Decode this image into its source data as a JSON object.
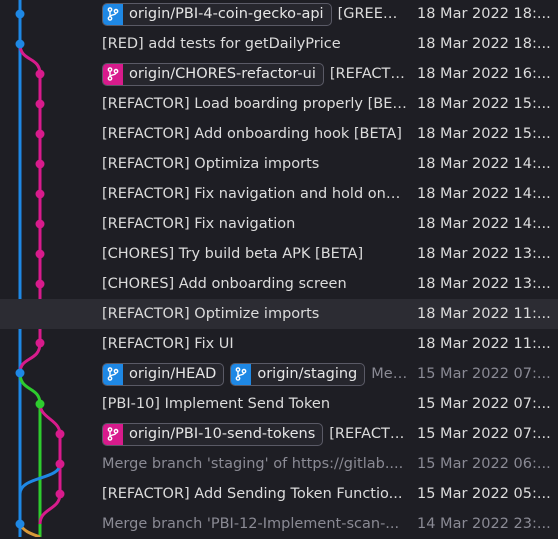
{
  "colors": {
    "blue": "#1e88e5",
    "magenta": "#d81b8c",
    "green": "#2ecc2e",
    "orange": "#d99a3a"
  },
  "commits": [
    {
      "refs": [
        {
          "name": "origin/PBI-4-coin-gecko-api",
          "color": "#1e88e5"
        }
      ],
      "message": "[GREEN] ...",
      "date": "18 Mar 2022 18:...",
      "dim": false
    },
    {
      "refs": [],
      "message": "[RED] add tests for getDailyPrice",
      "date": "18 Mar 2022 18:...",
      "dim": false
    },
    {
      "refs": [
        {
          "name": "origin/CHORES-refactor-ui",
          "color": "#d81b8c"
        }
      ],
      "message": "[REFACTO...",
      "date": "18 Mar 2022 16:...",
      "dim": false
    },
    {
      "refs": [],
      "message": "[REFACTOR] Load boarding properly [BET...",
      "date": "18 Mar 2022 15:...",
      "dim": false
    },
    {
      "refs": [],
      "message": "[REFACTOR] Add onboarding hook [BETA]",
      "date": "18 Mar 2022 15:...",
      "dim": false
    },
    {
      "refs": [],
      "message": "[REFACTOR] Optimiza imports",
      "date": "18 Mar 2022 14:...",
      "dim": false
    },
    {
      "refs": [],
      "message": "[REFACTOR] Fix navigation and hold onb...",
      "date": "18 Mar 2022 14:...",
      "dim": false
    },
    {
      "refs": [],
      "message": "[REFACTOR] Fix navigation",
      "date": "18 Mar 2022 14:...",
      "dim": false
    },
    {
      "refs": [],
      "message": "[CHORES] Try build beta APK [BETA]",
      "date": "18 Mar 2022 13:...",
      "dim": false
    },
    {
      "refs": [],
      "message": "[CHORES] Add onboarding screen",
      "date": "18 Mar 2022 13:...",
      "dim": false
    },
    {
      "refs": [],
      "message": "[REFACTOR] Optimize imports",
      "date": "18 Mar 2022 11:...",
      "dim": false,
      "selected": true
    },
    {
      "refs": [],
      "message": "[REFACTOR] Fix UI",
      "date": "18 Mar 2022 11:...",
      "dim": false
    },
    {
      "refs": [
        {
          "name": "origin/HEAD",
          "color": "#1e88e5"
        },
        {
          "name": "origin/staging",
          "color": "#1e88e5"
        }
      ],
      "message": "Mer...",
      "date": "15 Mar 2022 07:...",
      "dim": true
    },
    {
      "refs": [],
      "message": "[PBI-10] Implement Send Token",
      "date": "15 Mar 2022 07:...",
      "dim": false
    },
    {
      "refs": [
        {
          "name": "origin/PBI-10-send-tokens",
          "color": "#d81b8c"
        }
      ],
      "message": "[REFACTO...",
      "date": "15 Mar 2022 07:...",
      "dim": false
    },
    {
      "refs": [],
      "message": "Merge branch 'staging' of https://gitlab....",
      "date": "15 Mar 2022 06:...",
      "dim": true
    },
    {
      "refs": [],
      "message": "[REFACTOR] Add Sending Token Functio...",
      "date": "15 Mar 2022 05:...",
      "dim": false
    },
    {
      "refs": [],
      "message": "Merge branch 'PBI-12-Implement-scan-...",
      "date": "14 Mar 2022 23:...",
      "dim": true
    }
  ]
}
